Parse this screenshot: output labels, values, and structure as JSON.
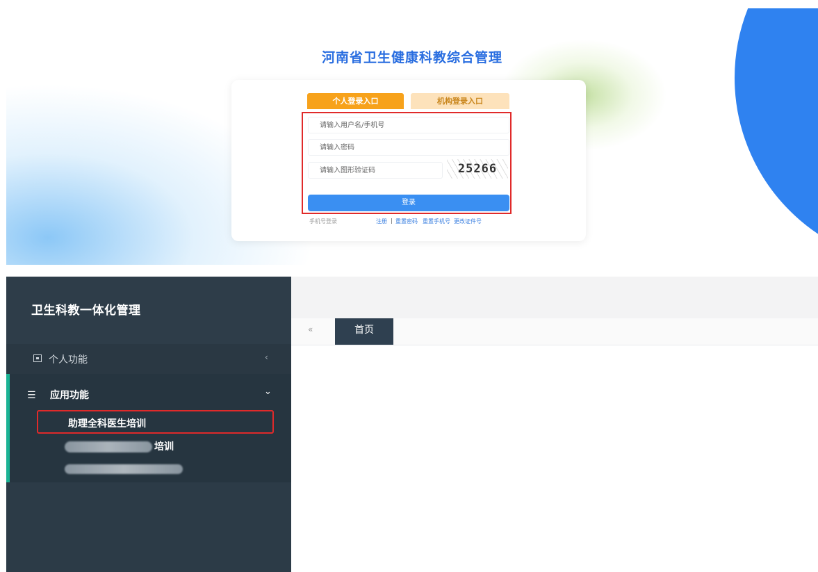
{
  "login": {
    "system_title": "河南省卫生健康科教综合管理",
    "tabs": [
      {
        "label": "个人登录入口",
        "active": true
      },
      {
        "label": "机构登录入口",
        "active": false
      }
    ],
    "username_placeholder": "请输入用户名/手机号",
    "password_placeholder": "请输入密码",
    "captcha_placeholder": "请输入图形验证码",
    "captcha_text": "25266",
    "login_button": "登录",
    "phone_login": "手机号登录",
    "links": {
      "register": "注册",
      "separator": "|",
      "reset_password": "重置密码",
      "reset_phone": "重置手机号",
      "change_id": "更改证件号"
    },
    "colors": {
      "title": "#2a6ee0",
      "active_tab": "#f7a21b",
      "button": "#3a8ff2",
      "highlight": "#e02a2a"
    }
  },
  "admin": {
    "brand_title": "卫生科教一体化管理",
    "menu": {
      "personal": {
        "label": "个人功能",
        "icon": "id-card-icon",
        "arrow": "‹"
      },
      "apps": {
        "label": "应用功能",
        "icon": "list-icon",
        "arrow": "⌄"
      },
      "apps_items": [
        {
          "label": "助理全科医生培训",
          "highlighted": true
        },
        {
          "label": "培训",
          "blurred_prefix": true
        },
        {
          "label": "",
          "blurred": true
        }
      ]
    },
    "tabs": {
      "scroll_left_icon": "«",
      "home_label": "首页"
    },
    "colors": {
      "sidebar": "#2c3b47",
      "active_border": "#1ab394",
      "highlight": "#e02a2a"
    }
  }
}
